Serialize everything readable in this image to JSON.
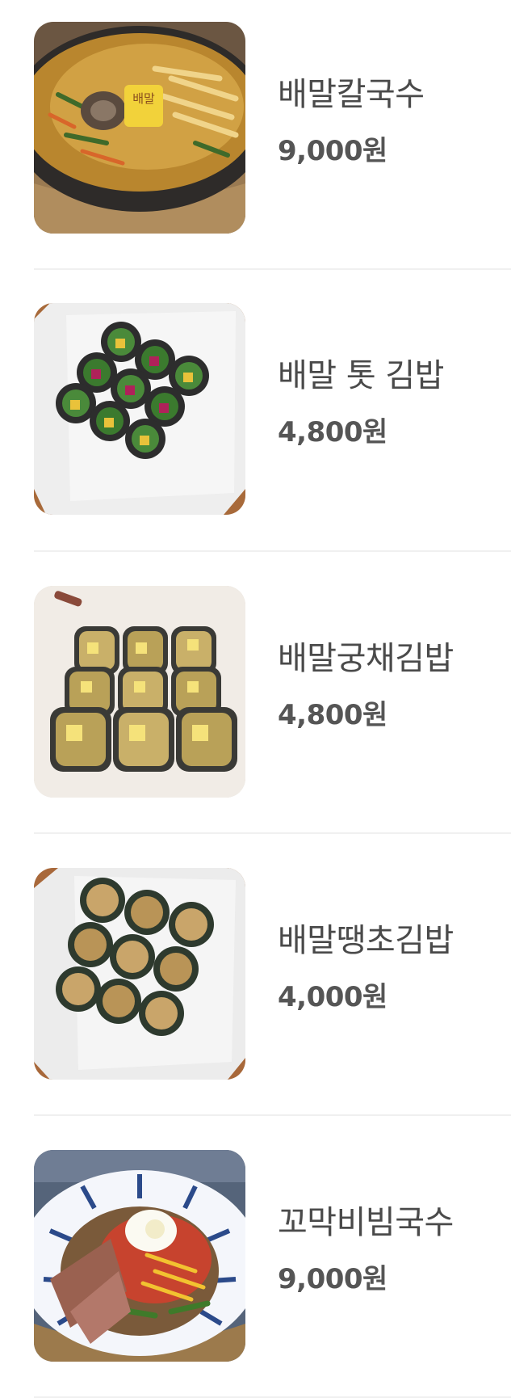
{
  "menu": {
    "items": [
      {
        "name": "배말칼국수",
        "price": "9,000원",
        "photo_icon": "noodle-soup-photo"
      },
      {
        "name": "배말 톳 김밥",
        "price": "4,800원",
        "photo_icon": "kimbap-photo"
      },
      {
        "name": "배말궁채김밥",
        "price": "4,800원",
        "photo_icon": "kimbap-photo"
      },
      {
        "name": "배말땡초김밥",
        "price": "4,000원",
        "photo_icon": "kimbap-photo"
      },
      {
        "name": "꼬막비빔국수",
        "price": "9,000원",
        "photo_icon": "bibim-noodle-photo"
      }
    ]
  },
  "photo_text": {
    "stamp": "배말"
  },
  "colors": {
    "name_text": "#4a4a4a",
    "price_text": "#555555",
    "divider": "#f0f0f0",
    "background": "#ffffff"
  }
}
